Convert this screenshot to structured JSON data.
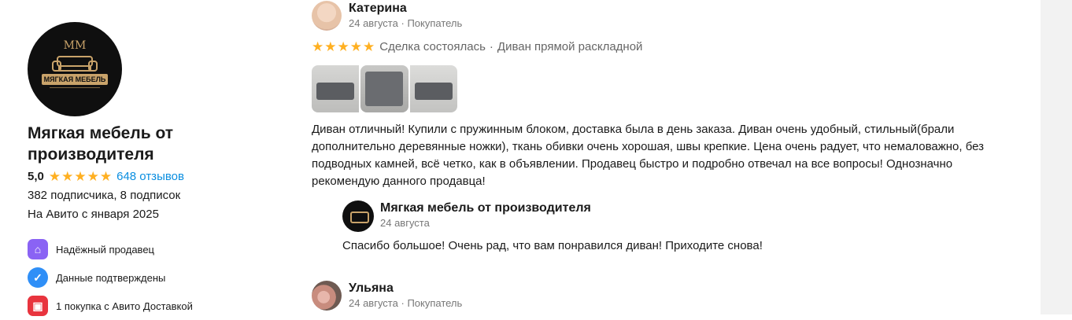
{
  "seller": {
    "logo_top": "MM",
    "logo_brand": "МЯГКАЯ МЕБЕЛЬ",
    "name": "Мягкая мебель от производителя",
    "rating": "5,0",
    "reviews_link": "648 отзывов",
    "subscribers": "382 подписчика, 8 подписок",
    "since": "На Авито с января 2025",
    "badges": [
      {
        "label": "Надёжный продавец",
        "icon": "shield-home-icon",
        "color": "#8a63f4"
      },
      {
        "label": "Данные подтверждены",
        "icon": "verified-check-icon",
        "color": "#2f8ff7"
      },
      {
        "label": "1 покупка с Авито Доставкой",
        "icon": "delivery-box-icon",
        "color": "#e8343e"
      }
    ]
  },
  "reviews": [
    {
      "author": "Катерина",
      "date": "24 августа",
      "role": "Покупатель",
      "status": "Сделка состоялась",
      "item": "Диван прямой раскладной",
      "stars": 5,
      "text": "Диван отличный! Купили с пружинным блоком, доставка была в день заказа. Диван очень удобный, стильный(брали дополнительно деревянные ножки), ткань обивки очень хорошая, швы крепкие. Цена очень радует, что немаловажно, без подводных камней, всё четко, как в объявлении. Продавец быстро и подробно отвечал на все вопросы! Однозначно рекомендую данного продавца!",
      "reply": {
        "author": "Мягкая мебель от производителя",
        "date": "24 августа",
        "text": "Спасибо большое! Очень рад, что вам понравился диван! Приходите снова!"
      }
    },
    {
      "author": "Ульяна",
      "date": "24 августа",
      "role": "Покупатель"
    }
  ],
  "separator": "·",
  "colors": {
    "star": "#ffb021",
    "link": "#0a8ee0"
  }
}
